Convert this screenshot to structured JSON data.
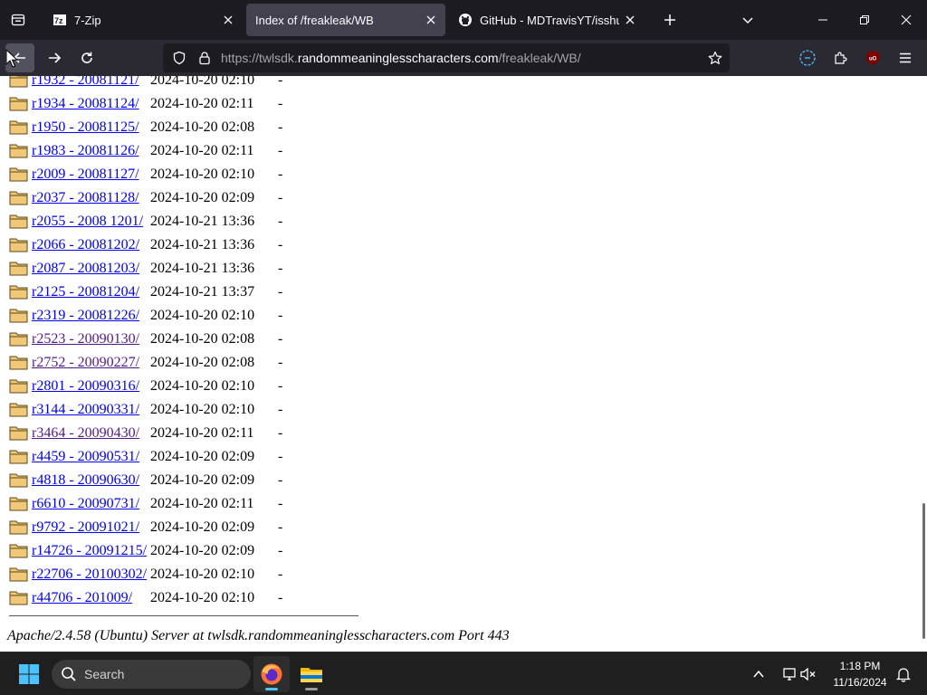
{
  "browser": {
    "tabs": [
      {
        "label": "7-Zip",
        "icon": "7zip-favicon-icon",
        "active": false
      },
      {
        "label": "Index of /freakleak/WB",
        "icon": "none",
        "active": true
      },
      {
        "label": "GitHub - MDTravisYT/isshus-m",
        "icon": "github-icon",
        "active": false
      }
    ],
    "url": {
      "prefix": "https://twlsdk.",
      "host": "randommeaninglesscharacters.com",
      "path": "/freakleak/WB/"
    }
  },
  "listing": {
    "entries": [
      {
        "name": "r1932 - 20081121/",
        "modified": "2024-10-20 02:10",
        "size": "-",
        "visited": false
      },
      {
        "name": "r1934 - 20081124/",
        "modified": "2024-10-20 02:11",
        "size": "-",
        "visited": false
      },
      {
        "name": "r1950 - 20081125/",
        "modified": "2024-10-20 02:08",
        "size": "-",
        "visited": false
      },
      {
        "name": "r1983 - 20081126/",
        "modified": "2024-10-20 02:11",
        "size": "-",
        "visited": false
      },
      {
        "name": "r2009 - 20081127/",
        "modified": "2024-10-20 02:10",
        "size": "-",
        "visited": false
      },
      {
        "name": "r2037 - 20081128/",
        "modified": "2024-10-20 02:09",
        "size": "-",
        "visited": false
      },
      {
        "name": "r2055 - 2008 1201/",
        "modified": "2024-10-21 13:36",
        "size": "-",
        "visited": false
      },
      {
        "name": "r2066 - 20081202/",
        "modified": "2024-10-21 13:36",
        "size": "-",
        "visited": false
      },
      {
        "name": "r2087 - 20081203/",
        "modified": "2024-10-21 13:36",
        "size": "-",
        "visited": false
      },
      {
        "name": "r2125 - 20081204/",
        "modified": "2024-10-21 13:37",
        "size": "-",
        "visited": false
      },
      {
        "name": "r2319 - 20081226/",
        "modified": "2024-10-20 02:10",
        "size": "-",
        "visited": false
      },
      {
        "name": "r2523 - 20090130/",
        "modified": "2024-10-20 02:08",
        "size": "-",
        "visited": true
      },
      {
        "name": "r2752 - 20090227/",
        "modified": "2024-10-20 02:08",
        "size": "-",
        "visited": true
      },
      {
        "name": "r2801 - 20090316/",
        "modified": "2024-10-20 02:10",
        "size": "-",
        "visited": false
      },
      {
        "name": "r3144 - 20090331/",
        "modified": "2024-10-20 02:10",
        "size": "-",
        "visited": false
      },
      {
        "name": "r3464 - 20090430/",
        "modified": "2024-10-20 02:11",
        "size": "-",
        "visited": true
      },
      {
        "name": "r4459 - 20090531/",
        "modified": "2024-10-20 02:09",
        "size": "-",
        "visited": false
      },
      {
        "name": "r4818 - 20090630/",
        "modified": "2024-10-20 02:09",
        "size": "-",
        "visited": false
      },
      {
        "name": "r6610 - 20090731/",
        "modified": "2024-10-20 02:11",
        "size": "-",
        "visited": false
      },
      {
        "name": "r9792 - 20091021/",
        "modified": "2024-10-20 02:09",
        "size": "-",
        "visited": false
      },
      {
        "name": "r14726 - 20091215/",
        "modified": "2024-10-20 02:09",
        "size": "-",
        "visited": false
      },
      {
        "name": "r22706 - 20100302/",
        "modified": "2024-10-20 02:10",
        "size": "-",
        "visited": false
      },
      {
        "name": "r44706 - 201009/",
        "modified": "2024-10-20 02:10",
        "size": "-",
        "visited": false
      }
    ],
    "footer": "Apache/2.4.58 (Ubuntu) Server at twlsdk.randommeaninglesscharacters.com Port 443"
  },
  "taskbar": {
    "search_placeholder": "Search",
    "time": "1:18 PM",
    "date": "11/16/2024"
  },
  "colors": {
    "link": "#0000ee",
    "visited": "#551a8b",
    "accent": "#4cc2ff"
  }
}
